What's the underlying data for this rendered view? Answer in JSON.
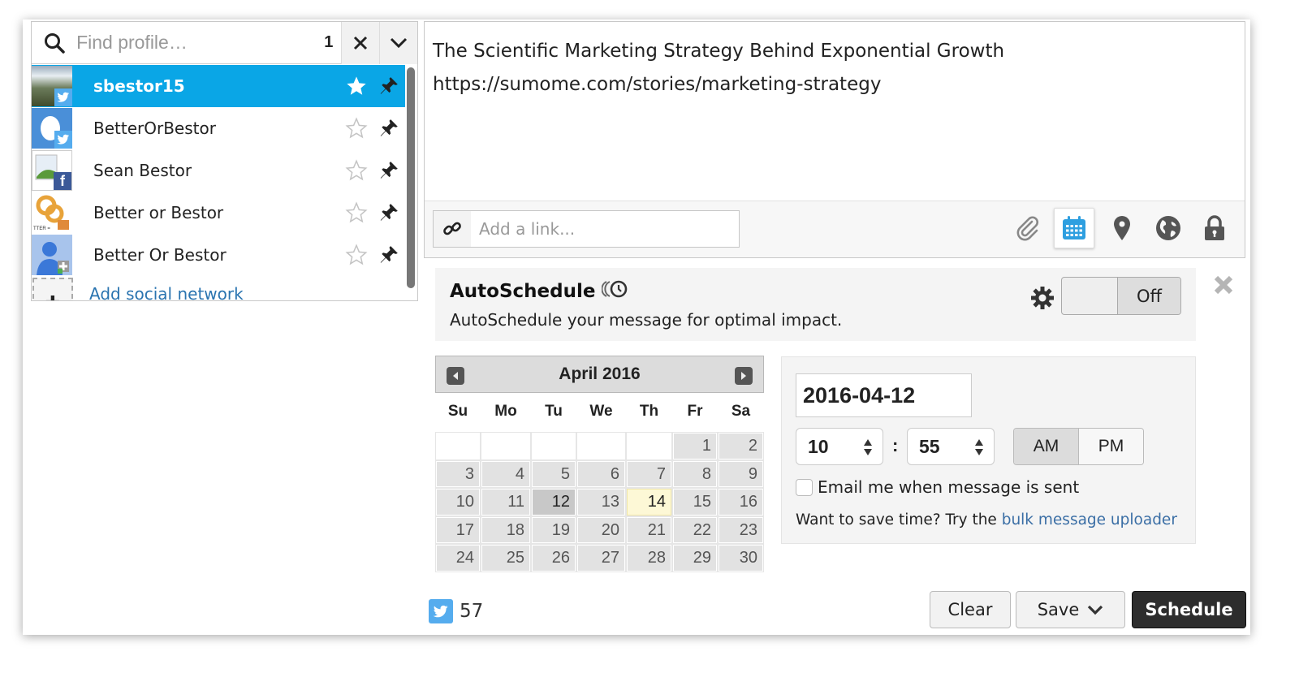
{
  "picker": {
    "search_placeholder": "Find profile…",
    "search_value": "",
    "selected_count": "1",
    "profiles": [
      {
        "name": "sbestor15",
        "network": "twitter",
        "selected": true,
        "favorite": true
      },
      {
        "name": "BetterOrBestor",
        "network": "twitter",
        "selected": false,
        "favorite": false
      },
      {
        "name": "Sean Bestor",
        "network": "facebook",
        "selected": false,
        "favorite": false
      },
      {
        "name": "Better or Bestor",
        "network": "facebook-page",
        "selected": false,
        "favorite": false
      },
      {
        "name": "Better Or Bestor",
        "network": "google-plus",
        "selected": false,
        "favorite": false
      }
    ],
    "add_network_label": "Add social network"
  },
  "composer": {
    "message": "The Scientific Marketing Strategy Behind Exponential Growth\nhttps://sumome.com/stories/marketing-strategy",
    "link_placeholder": "Add a link...",
    "tools": [
      "attachment-icon",
      "calendar-icon",
      "location-pin-icon",
      "globe-icon",
      "lock-icon"
    ],
    "active_tool": "calendar-icon"
  },
  "autoschedule": {
    "title": "AutoSchedule",
    "description": "AutoSchedule your message for optimal impact.",
    "toggle_label": "Off"
  },
  "calendar": {
    "title": "April 2016",
    "weekdays": [
      "Su",
      "Mo",
      "Tu",
      "We",
      "Th",
      "Fr",
      "Sa"
    ],
    "first_weekday_index": 5,
    "days_in_month": 30,
    "selected_day": 12,
    "today_day": 14
  },
  "schedule": {
    "date": "2016-04-12",
    "hour": "10",
    "minute": "55",
    "separator": ":",
    "am_label": "AM",
    "pm_label": "PM",
    "period": "AM",
    "email_label": "Email me when message is sent",
    "email_checked": false,
    "bulk_prefix": "Want to save time? Try the ",
    "bulk_link": "bulk message uploader"
  },
  "footer": {
    "char_count": "57",
    "clear_label": "Clear",
    "save_label": "Save",
    "schedule_label": "Schedule"
  },
  "colors": {
    "selected_row": "#0aa6e6",
    "twitter": "#55acee",
    "facebook": "#3b5998",
    "link": "#3a6ea5",
    "primary_button": "#2d2d2d",
    "today_highlight": "#fdf8d6"
  }
}
